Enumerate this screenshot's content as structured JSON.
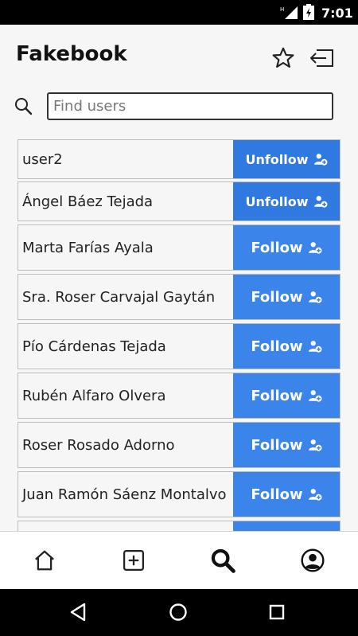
{
  "status_bar": {
    "time": "7:01"
  },
  "header": {
    "title": "Fakebook"
  },
  "search": {
    "placeholder": "Find users",
    "value": ""
  },
  "users": [
    {
      "name": "user2",
      "action": "Unfollow",
      "following": true
    },
    {
      "name": "Ángel Báez Tejada",
      "action": "Unfollow",
      "following": true
    },
    {
      "name": "Marta Farías Ayala",
      "action": "Follow",
      "following": false
    },
    {
      "name": "Sra. Roser Carvajal Gaytán",
      "action": "Follow",
      "following": false
    },
    {
      "name": "Pío Cárdenas Tejada",
      "action": "Follow",
      "following": false
    },
    {
      "name": "Rubén Alfaro Olvera",
      "action": "Follow",
      "following": false
    },
    {
      "name": "Roser Rosado Adorno",
      "action": "Follow",
      "following": false
    },
    {
      "name": "Juan Ramón Sáenz Montalvo",
      "action": "Follow",
      "following": false
    },
    {
      "name": "",
      "action": "",
      "following": false
    }
  ],
  "nav": {
    "items": [
      {
        "icon": "home-icon"
      },
      {
        "icon": "add-post-icon"
      },
      {
        "icon": "search-icon",
        "active": true
      },
      {
        "icon": "profile-icon"
      }
    ]
  },
  "colors": {
    "unfollow": "#2f79e0",
    "follow": "#3b85ea"
  }
}
